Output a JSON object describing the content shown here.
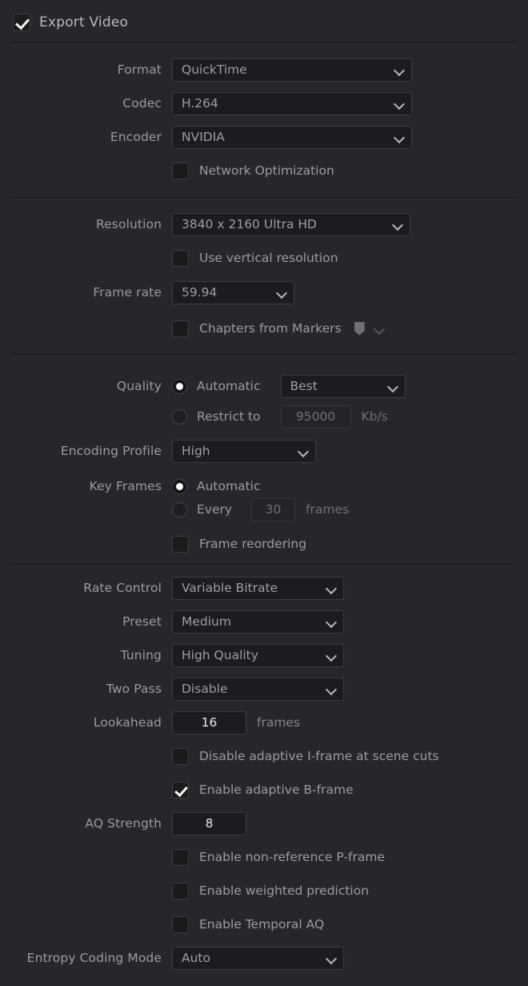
{
  "panel": {
    "title": "Export Video",
    "export_video_checked": true
  },
  "format_section": {
    "rows": [
      {
        "label": "Format",
        "value": "QuickTime",
        "icon": "chevron-down-icon"
      },
      {
        "label": "Codec",
        "value": "H.264",
        "icon": "chevron-down-icon"
      },
      {
        "label": "Encoder",
        "value": "NVIDIA",
        "icon": "chevron-down-icon"
      }
    ],
    "network_optimization": {
      "label": "Network Optimization",
      "checked": false
    }
  },
  "resolution_section": {
    "resolution": {
      "label": "Resolution",
      "value": "3840 x 2160 Ultra HD"
    },
    "use_vertical_resolution": {
      "label": "Use vertical resolution",
      "checked": false
    },
    "frame_rate": {
      "label": "Frame rate",
      "value": "59.94"
    },
    "chapters_from_markers": {
      "label": "Chapters from Markers",
      "checked": false,
      "marker_icon": "marker-swatch-icon",
      "chevron": "chevron-down-icon"
    }
  },
  "quality_section": {
    "label": "Quality",
    "automatic": {
      "label": "Automatic",
      "selected": true
    },
    "automatic_value": "Best",
    "restrict_to": {
      "label": "Restrict to",
      "selected": false
    },
    "restrict_value": "95000",
    "restrict_unit": "Kb/s",
    "encoding_profile": {
      "label": "Encoding Profile",
      "value": "High"
    },
    "key_frames": {
      "label": "Key Frames",
      "automatic": {
        "label": "Automatic",
        "selected": true
      },
      "every": {
        "label": "Every",
        "selected": false
      },
      "every_value": "30",
      "every_unit": "frames"
    },
    "frame_reordering": {
      "label": "Frame reordering",
      "checked": false
    }
  },
  "encoder_section": {
    "rate_control": {
      "label": "Rate Control",
      "value": "Variable Bitrate"
    },
    "preset": {
      "label": "Preset",
      "value": "Medium"
    },
    "tuning": {
      "label": "Tuning",
      "value": "High Quality"
    },
    "two_pass": {
      "label": "Two Pass",
      "value": "Disable"
    },
    "lookahead": {
      "label": "Lookahead",
      "value": "16",
      "unit": "frames"
    },
    "disable_adaptive_iframe": {
      "label": "Disable adaptive I-frame at scene cuts",
      "checked": false
    },
    "enable_adaptive_bframe": {
      "label": "Enable adaptive B-frame",
      "checked": true
    },
    "aq_strength": {
      "label": "AQ Strength",
      "value": "8"
    },
    "enable_non_reference_pframe": {
      "label": "Enable non-reference P-frame",
      "checked": false
    },
    "enable_weighted_prediction": {
      "label": "Enable weighted prediction",
      "checked": false
    },
    "enable_temporal_aq": {
      "label": "Enable Temporal AQ",
      "checked": false
    },
    "entropy_coding_mode": {
      "label": "Entropy Coding Mode",
      "value": "Auto"
    }
  },
  "colors": {
    "background": "#26262b",
    "control_fill": "#1c1c20",
    "text": "#9b9ba0",
    "value_active": "#e8e8ee"
  }
}
